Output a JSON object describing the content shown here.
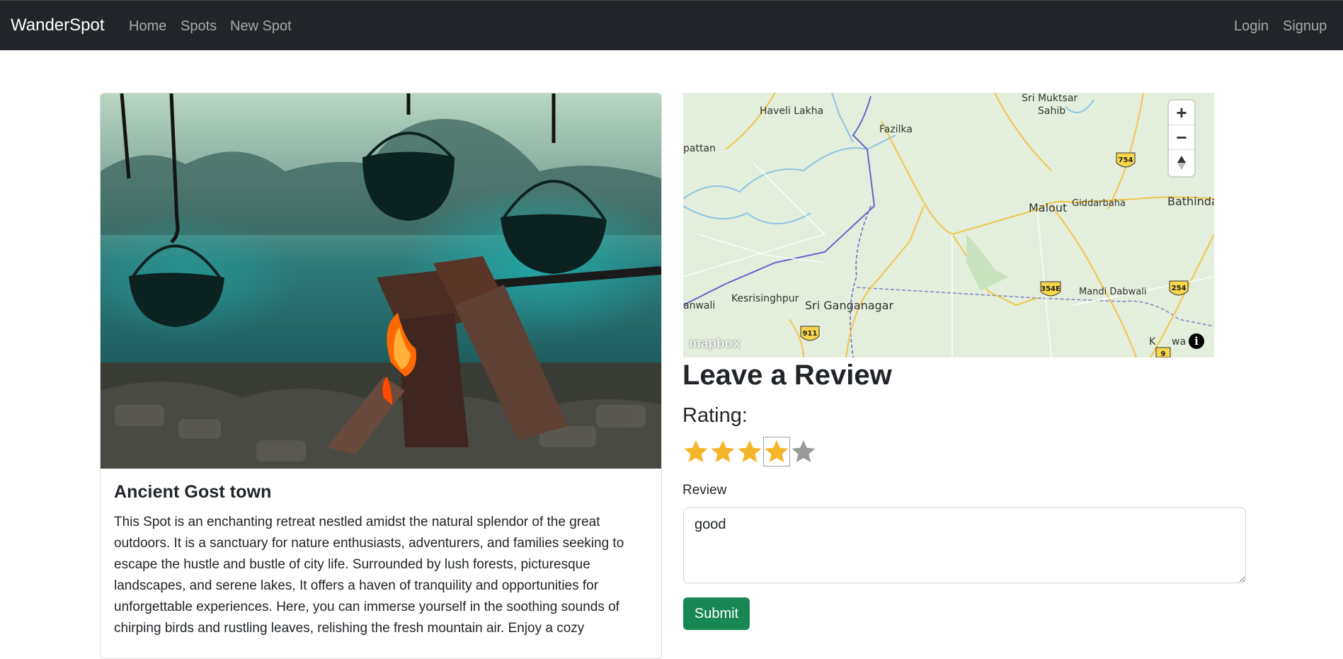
{
  "navbar": {
    "brand": "WanderSpot",
    "links": [
      "Home",
      "Spots",
      "New Spot"
    ],
    "auth": [
      "Login",
      "Signup"
    ]
  },
  "spot": {
    "title": "Ancient Gost town",
    "description": "This Spot is an enchanting retreat nestled amidst the natural splendor of the great outdoors. It is a sanctuary for nature enthusiasts, adventurers, and families seeking to escape the hustle and bustle of city life. Surrounded by lush forests, picturesque landscapes, and serene lakes, It offers a haven of tranquility and opportunities for unforgettable experiences. Here, you can immerse yourself in the soothing sounds of chirping birds and rustling leaves, relishing the fresh mountain air. Enjoy a cozy"
  },
  "map": {
    "zoom_in": "+",
    "zoom_out": "−",
    "compass": "▲",
    "attribution_logo": "mapbox",
    "info": "i",
    "places": [
      "Haveli Lakha",
      "Sri Muktsar",
      "Sahib",
      "Fazilka",
      "pattan",
      "Malout",
      "Giddarbaha",
      "Bathinda",
      "Kesrisinghpur",
      "Sri Ganganagar",
      "Mandi Dabwali",
      "anwali",
      "K",
      "wa"
    ],
    "road_shields": [
      "754",
      "354E",
      "254",
      "911",
      "9"
    ]
  },
  "review_form": {
    "heading": "Leave a Review",
    "rating_label": "Rating:",
    "rating": 4,
    "max_rating": 5,
    "review_label": "Review",
    "review_value": "good",
    "submit_label": "Submit"
  },
  "colors": {
    "navbar_bg": "#212529",
    "star_filled": "#f5b52a",
    "star_empty": "#9a9a9a",
    "submit_bg": "#198754"
  }
}
